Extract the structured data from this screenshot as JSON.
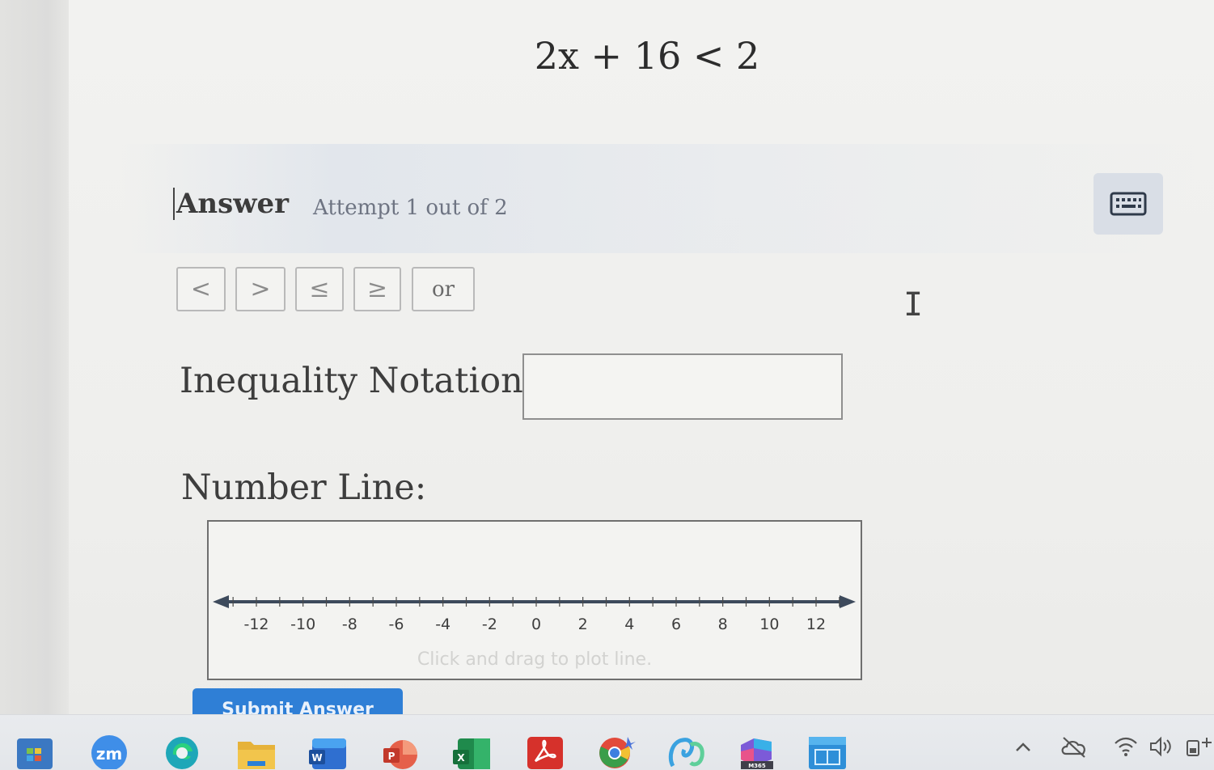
{
  "equation": "2x + 16 < 2",
  "answer": {
    "title": "Answer",
    "attempt": "Attempt 1 out of 2"
  },
  "symbols": [
    "<",
    ">",
    "≤",
    "≥",
    "or"
  ],
  "inequality": {
    "label": "Inequality Notation:",
    "value": ""
  },
  "number_line": {
    "label": "Number Line:",
    "ticks": [
      -12,
      -10,
      -8,
      -6,
      -4,
      -2,
      0,
      2,
      4,
      6,
      8,
      10,
      12
    ],
    "min": -14,
    "max": 14,
    "hint": "Click and drag to plot line."
  },
  "submit_label": "Submit Answer",
  "taskbar": {
    "apps": [
      "windows-app-icon",
      "zoom-icon",
      "edge-icon",
      "file-explorer-icon",
      "word-icon",
      "powerpoint-icon",
      "excel-icon",
      "acrobat-icon",
      "chrome-icon",
      "copilot-icon",
      "microsoft-365-icon",
      "store-icon"
    ],
    "tray": [
      "chevron-up-icon",
      "cloud-off-icon",
      "wifi-icon",
      "volume-icon",
      "battery-icon"
    ]
  },
  "colors": {
    "submit": "#2f7fd6",
    "keyboard_button": "#d9dee6"
  }
}
